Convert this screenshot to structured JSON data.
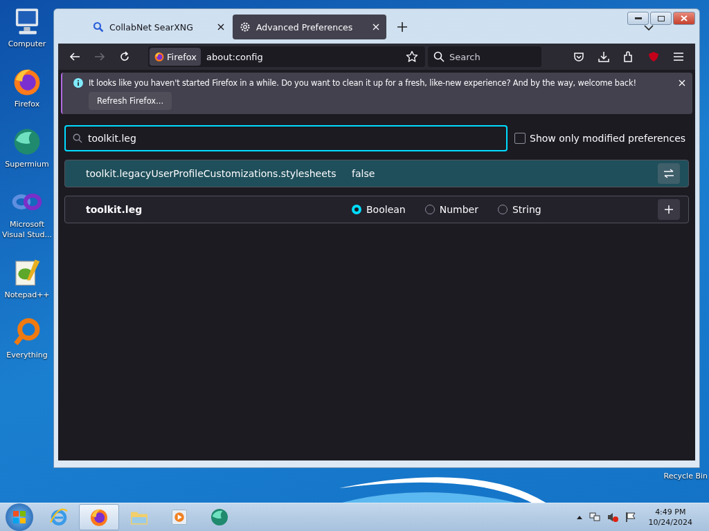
{
  "desktop_icons": [
    {
      "kind": "computer",
      "label": "Computer"
    },
    {
      "kind": "firefox",
      "label": "Firefox"
    },
    {
      "kind": "supermium",
      "label": "Supermium"
    },
    {
      "kind": "vs",
      "label": "Microsoft Visual Stud..."
    },
    {
      "kind": "notepad",
      "label": "Notepad++"
    },
    {
      "kind": "everything",
      "label": "Everything"
    }
  ],
  "recycle_bin": {
    "label": "Recycle Bin"
  },
  "tabs": [
    {
      "kind": "search",
      "label": "CollabNet SearXNG",
      "selected": false
    },
    {
      "kind": "settings",
      "label": "Advanced Preferences",
      "selected": true
    }
  ],
  "toolbar": {
    "identity": "Firefox",
    "url": "about:config",
    "search_placeholder": "Search"
  },
  "notification": {
    "message": "It looks like you haven't started Firefox in a while. Do you want to clean it up for a fresh, like-new experience? And by the way, welcome back!",
    "button": "Refresh Firefox..."
  },
  "config": {
    "search_value": "toolkit.leg",
    "modified_only": {
      "label": "Show only modified preferences",
      "checked": false
    },
    "preferences": [
      {
        "name": "toolkit.legacyUserProfileCustomizations.stylesheets",
        "value": "false",
        "selected": true
      }
    ],
    "new_preference": {
      "name": "toolkit.leg",
      "types": [
        {
          "label": "Boolean",
          "selected": true
        },
        {
          "label": "Number",
          "selected": false
        },
        {
          "label": "String",
          "selected": false
        }
      ]
    }
  },
  "taskbar": {
    "apps": [
      {
        "kind": "ie",
        "selected": false
      },
      {
        "kind": "firefox",
        "selected": true
      },
      {
        "kind": "folder",
        "selected": false
      },
      {
        "kind": "media",
        "selected": false
      },
      {
        "kind": "supermium",
        "selected": false
      }
    ],
    "time": "4:49 PM",
    "date": "10/24/2024"
  }
}
